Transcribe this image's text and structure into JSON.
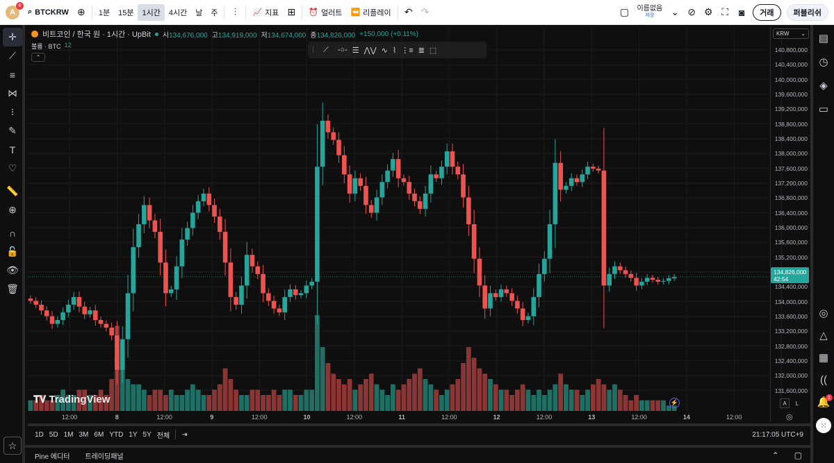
{
  "topbar": {
    "avatar_letter": "A",
    "avatar_badge": "6",
    "symbol": "BTCKRW",
    "intervals": [
      "1분",
      "15분",
      "1시간",
      "4시간",
      "날",
      "주"
    ],
    "active_interval": "1시간",
    "indicators_label": "지표",
    "alert_label": "얼러트",
    "replay_label": "리플레이",
    "layout_name": "이름없음",
    "layout_status": "저장",
    "trade_button": "거래",
    "publish_button": "퍼블리쉬"
  },
  "legend": {
    "title": "비트코인 / 한국 원 · 1시간 · UpBit",
    "o_label": "시",
    "o": "134,676,000",
    "h_label": "고",
    "h": "134,919,000",
    "l_label": "저",
    "l": "134,674,000",
    "c_label": "종",
    "c": "134,826,000",
    "change": "+150,000 (+0.11%)",
    "volume_label": "볼륨 · BTC",
    "volume_value": "12"
  },
  "currency": "KRW",
  "price_axis": [
    "140,800,000",
    "140,400,000",
    "140,000,000",
    "139,600,000",
    "139,200,000",
    "138,800,000",
    "138,400,000",
    "138,000,000",
    "137,600,000",
    "137,200,000",
    "136,800,000",
    "136,400,000",
    "136,000,000",
    "135,600,000",
    "135,200,000",
    "134,400,000",
    "134,000,000",
    "133,600,000",
    "133,200,000",
    "132,800,000",
    "132,400,000",
    "132,000,000",
    "131,600,000"
  ],
  "current_price": "134,826,000",
  "countdown": "42:54",
  "time_axis": [
    "12:00",
    "8",
    "12:00",
    "9",
    "12:00",
    "10",
    "12:00",
    "11",
    "12:00",
    "12",
    "12:00",
    "13",
    "12:00",
    "14",
    "12:00"
  ],
  "watermark": "TradingView",
  "auto_labels": [
    "A",
    "L"
  ],
  "range_buttons": [
    "1D",
    "5D",
    "1M",
    "3M",
    "6M",
    "YTD",
    "1Y",
    "5Y",
    "전체"
  ],
  "clock": "21:17:05 UTC+9",
  "bottom_tabs": [
    "Pine 에디터",
    "트레이딩패널"
  ],
  "colors": {
    "up": "#26a69a",
    "down": "#ef5350",
    "up_vol": "#1f6f65",
    "down_vol": "#8c3535"
  },
  "chart_data": {
    "type": "candlestick",
    "ylim": [
      131400000,
      141000000
    ],
    "closes": [
      134200000,
      134100000,
      133950000,
      133800000,
      133600000,
      133700000,
      133900000,
      134100000,
      134300000,
      134050000,
      133850000,
      133950000,
      133700000,
      133600000,
      133500000,
      133300000,
      132400000,
      133200000,
      134400000,
      135600000,
      136200000,
      136700000,
      136300000,
      136000000,
      135200000,
      134400000,
      134500000,
      135100000,
      135800000,
      136100000,
      136500000,
      136800000,
      137000000,
      136700000,
      136400000,
      136000000,
      135200000,
      134300000,
      134100000,
      134600000,
      135400000,
      135100000,
      134900000,
      134400000,
      134200000,
      134000000,
      133900000,
      134300000,
      134500000,
      134350000,
      134400000,
      134600000,
      134700000,
      137700000,
      138900000,
      138600000,
      138400000,
      138000000,
      137500000,
      137000000,
      137400000,
      137200000,
      136700000,
      136500000,
      136900000,
      137300000,
      137600000,
      137900000,
      137400000,
      137300000,
      137000000,
      136800000,
      136600000,
      137000000,
      137500000,
      137400000,
      137700000,
      138100000,
      137700000,
      137500000,
      136900000,
      136200000,
      135300000,
      134600000,
      134000000,
      134400000,
      134300000,
      134500000,
      134400000,
      134200000,
      134000000,
      133700000,
      133800000,
      134300000,
      134900000,
      135300000,
      136200000,
      137800000,
      137100000,
      137200000,
      137400000,
      137300000,
      137500000,
      137700000,
      137650000,
      137600000,
      134600000,
      134900000,
      135100000,
      135000000,
      134900000,
      134800000,
      134600000,
      134700000,
      134800000,
      134750000,
      134700000,
      134720000,
      134790000,
      134826000
    ],
    "volumes": [
      2,
      2,
      3,
      2,
      2,
      3,
      4,
      3,
      3,
      4,
      4,
      3,
      3,
      4,
      3,
      6,
      16,
      12,
      6,
      5,
      5,
      4,
      3,
      4,
      4,
      3,
      4,
      3,
      3,
      4,
      5,
      4,
      3,
      3,
      4,
      5,
      8,
      6,
      4,
      3,
      3,
      4,
      4,
      3,
      3,
      4,
      3,
      4,
      4,
      3,
      3,
      4,
      4,
      18,
      12,
      9,
      7,
      6,
      5,
      6,
      4,
      5,
      6,
      7,
      5,
      4,
      3,
      5,
      4,
      5,
      6,
      7,
      8,
      6,
      5,
      4,
      3,
      4,
      5,
      6,
      9,
      12,
      10,
      8,
      7,
      6,
      5,
      4,
      4,
      3,
      4,
      5,
      4,
      3,
      4,
      3,
      4,
      5,
      7,
      5,
      4,
      4,
      3,
      4,
      5,
      6,
      5,
      4,
      5,
      4,
      3,
      2,
      3,
      2,
      2,
      2,
      2,
      2,
      1,
      1
    ]
  }
}
